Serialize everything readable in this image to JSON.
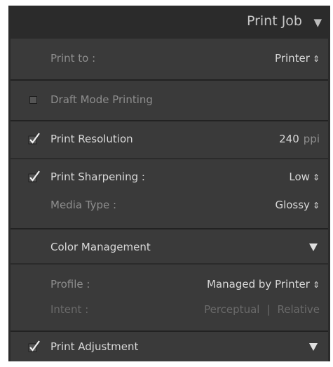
{
  "panel": {
    "title": "Print Job",
    "collapse_icon": "triangle-down-icon"
  },
  "print_to": {
    "label": "Print to :",
    "value": "Printer",
    "spinner_icon": "up-down-arrows-icon"
  },
  "draft_mode": {
    "label": "Draft Mode Printing",
    "checked": false
  },
  "print_resolution": {
    "label": "Print Resolution",
    "checked": true,
    "value": "240",
    "unit": "ppi"
  },
  "print_sharpening": {
    "label": "Print Sharpening :",
    "checked": true,
    "value": "Low"
  },
  "media_type": {
    "label": "Media Type :",
    "value": "Glossy"
  },
  "color_management": {
    "label": "Color Management",
    "expand_icon": "triangle-down-icon"
  },
  "profile": {
    "label": "Profile :",
    "value": "Managed by Printer"
  },
  "intent": {
    "label": "Intent :",
    "options": [
      "Perceptual",
      "Relative"
    ],
    "separator": "|"
  },
  "print_adjustment": {
    "label": "Print Adjustment",
    "checked": true,
    "expand_icon": "triangle-down-icon"
  },
  "colors": {
    "panel_bg": "#2b2b2b",
    "section_bg": "#3a3a3a",
    "text": "#d9d9d9",
    "dim_text": "#8e8e8e",
    "faint_text": "#6a6a6a",
    "title_text": "#c7c7c7"
  }
}
